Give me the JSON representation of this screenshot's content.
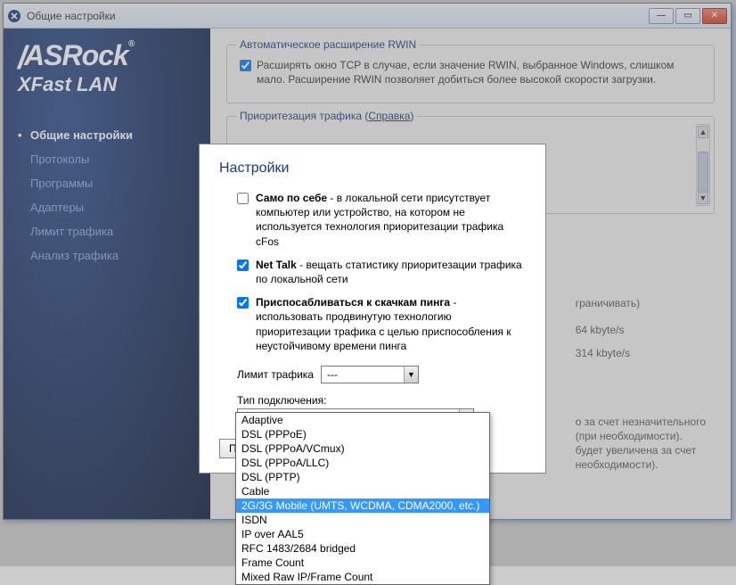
{
  "window": {
    "title": "Общие настройки"
  },
  "logo": {
    "brand": "ASRock",
    "product": "XFast LAN"
  },
  "nav": [
    "Общие настройки",
    "Протоколы",
    "Программы",
    "Адаптеры",
    "Лимит трафика",
    "Анализ трафика"
  ],
  "rwin": {
    "legend": "Автоматическое расширение RWIN",
    "check_label": "Расширять окно TCP в случае, если значение RWIN, выбранное Windows, слишком мало. Расширение RWIN позволяет добиться более высокой скорости загрузки."
  },
  "prio": {
    "legend_prefix": "Приоритезация трафика (",
    "legend_link": "Справка",
    "legend_suffix": ")"
  },
  "bg_fragments": {
    "limit_word": "граничивать)",
    "v1": "64 kbyte/s",
    "v2": "314 kbyte/s",
    "line1": "о за счет незначительного",
    "line2": "(при необходимости).",
    "line3": "будет увеличена за счет",
    "line4": "необходимости)."
  },
  "dialog": {
    "title": "Настройки",
    "opt1_bold": "Само по себе",
    "opt1_rest": " - в локальной сети присутствует компьютер или устройство, на котором не используется технология приоритезации трафика cFos",
    "opt2_bold": "Net Talk",
    "opt2_rest": " - вещать статистику приоритезации трафика по локальной сети",
    "opt3_bold": "Приспосабливаться к скачкам пинга",
    "opt3_rest": " - использовать продвинутую технологию приоритезации трафика с целью приспособления к неустойчивому времени пинга",
    "traffic_limit_label": "Лимит трафика",
    "traffic_limit_value": "---",
    "conn_type_label": "Тип подключения:",
    "conn_type_value": "Adaptive",
    "btn_partial": "Пр"
  },
  "dropdown": {
    "options": [
      "Adaptive",
      "DSL (PPPoE)",
      "DSL (PPPoA/VCmux)",
      "DSL (PPPoA/LLC)",
      "DSL (PPTP)",
      "Cable",
      "2G/3G Mobile (UMTS, WCDMA, CDMA2000, etc.)",
      "ISDN",
      "IP over AAL5",
      "RFC 1483/2684 bridged",
      "Frame Count",
      "Mixed Raw IP/Frame Count"
    ],
    "selected_index": 6
  }
}
